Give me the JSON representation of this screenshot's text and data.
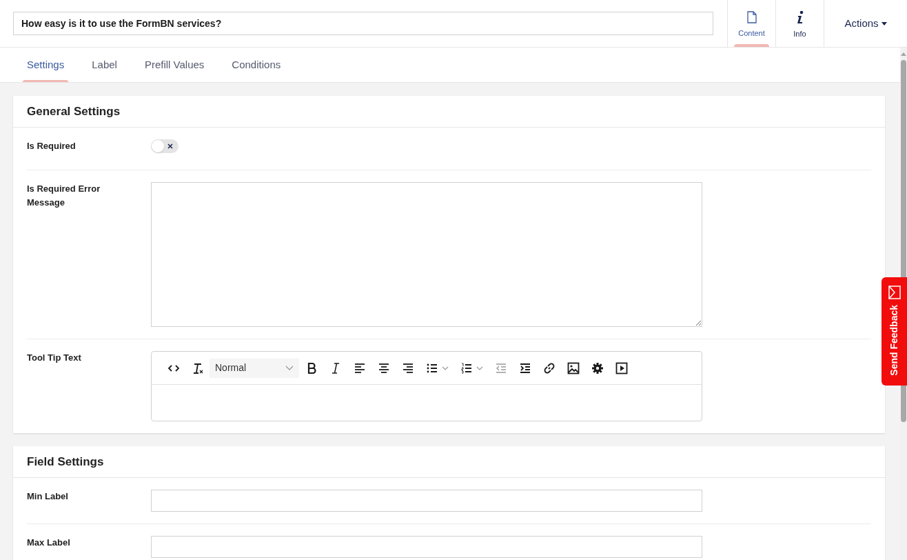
{
  "title_field": {
    "value": "How easy is it to use the FormBN services?"
  },
  "header_tabs": [
    {
      "kind": "content",
      "label": "Content",
      "selected": true
    },
    {
      "kind": "info",
      "label": "Info",
      "selected": false
    }
  ],
  "actions_menu": {
    "label": "Actions"
  },
  "tabs": [
    {
      "label": "Settings",
      "selected": true
    },
    {
      "label": "Label",
      "selected": false
    },
    {
      "label": "Prefill Values",
      "selected": false
    },
    {
      "label": "Conditions",
      "selected": false
    }
  ],
  "sections": [
    {
      "title": "General Settings",
      "fields": [
        {
          "kind": "toggle",
          "label": "Is Required",
          "on": false
        },
        {
          "kind": "textarea",
          "label": "Is Required Error Message"
        },
        {
          "kind": "richtext",
          "label": "Tool Tip Text",
          "format": "Normal"
        }
      ]
    },
    {
      "title": "Field Settings",
      "fields": [
        {
          "kind": "text",
          "label": "Min Label"
        },
        {
          "kind": "text",
          "label": "Max Label"
        }
      ]
    }
  ],
  "feedback_tab": {
    "label": "Send Feedback"
  }
}
